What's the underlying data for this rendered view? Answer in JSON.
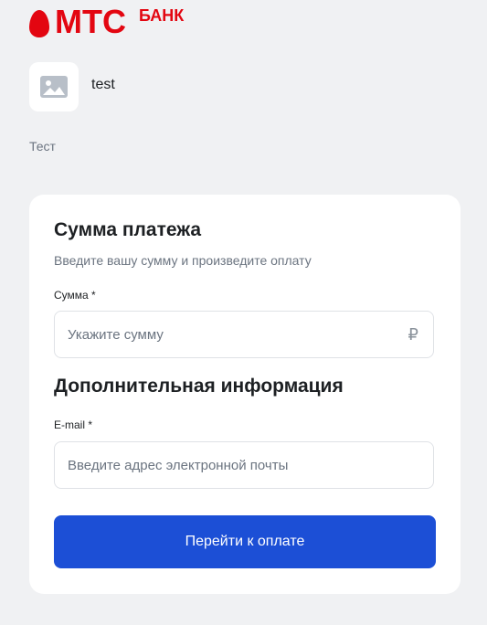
{
  "brand": {
    "name": "МТС",
    "suffix": "БАНК",
    "color": "#e30611"
  },
  "merchant": {
    "name": "test",
    "avatar_icon": "image-placeholder-icon",
    "description": "Тест"
  },
  "payment": {
    "title": "Сумма платежа",
    "subtitle": "Введите вашу сумму и произведите оплату",
    "amount_label": "Сумма *",
    "amount_placeholder": "Укажите сумму",
    "currency_symbol": "₽"
  },
  "extra": {
    "title": "Дополнительная информация",
    "email_label": "E-mail *",
    "email_placeholder": "Введите адрес электронной почты"
  },
  "submit": {
    "label": "Перейти к оплате",
    "color": "#1c4fd6"
  }
}
